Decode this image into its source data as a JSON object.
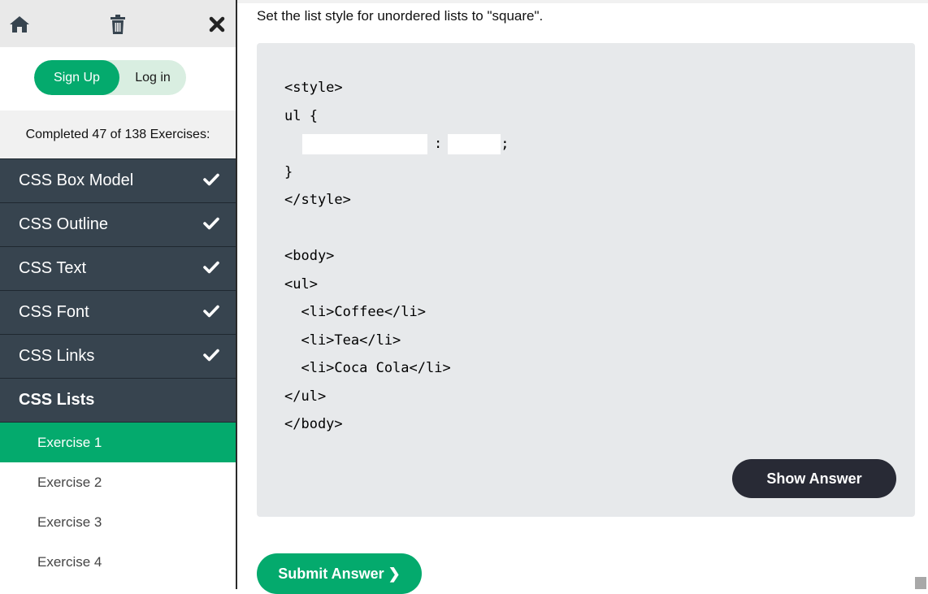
{
  "toolbar": {
    "home_icon": "home-icon",
    "trash_icon": "trash-icon",
    "close_icon": "close-icon"
  },
  "auth": {
    "signup_label": "Sign Up",
    "login_label": "Log in"
  },
  "progress": {
    "text": "Completed 47 of 138 Exercises:"
  },
  "sidebar": {
    "categories": [
      {
        "label": "CSS Box Model",
        "completed": true
      },
      {
        "label": "CSS Outline",
        "completed": true
      },
      {
        "label": "CSS Text",
        "completed": true
      },
      {
        "label": "CSS Font",
        "completed": true
      },
      {
        "label": "CSS Links",
        "completed": true
      },
      {
        "label": "CSS Lists",
        "completed": false
      }
    ],
    "exercises": [
      {
        "label": "Exercise 1",
        "active": true
      },
      {
        "label": "Exercise 2",
        "active": false
      },
      {
        "label": "Exercise 3",
        "active": false
      },
      {
        "label": "Exercise 4",
        "active": false
      }
    ]
  },
  "main": {
    "instruction": "Set the list style for unordered lists to \"square\".",
    "code": {
      "line1": "<style>",
      "line2": "ul {",
      "line3_colon": ":",
      "line3_semicolon": ";",
      "line4": "}",
      "line5": "</style>",
      "line7": "<body>",
      "line8": "<ul>",
      "line9": "  <li>Coffee</li>",
      "line10": "  <li>Tea</li>",
      "line11": "  <li>Coca Cola</li>",
      "line12": "</ul>",
      "line13": "</body>",
      "blank1_value": "",
      "blank2_value": ""
    },
    "show_answer_label": "Show Answer",
    "submit_label": "Submit Answer ❯"
  },
  "colors": {
    "accent": "#04aa6d",
    "sidebar_dark": "#37444f",
    "code_bg": "#e7e9eb",
    "button_dark": "#282a35"
  }
}
